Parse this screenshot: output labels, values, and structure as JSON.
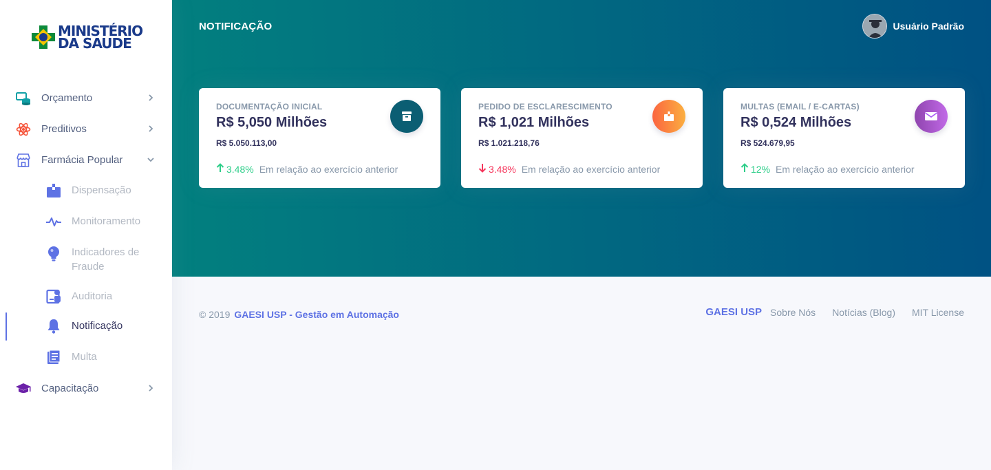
{
  "logo": {
    "line1": "MINISTÉRIO",
    "line2": "DA SAUDE"
  },
  "sidebar": {
    "items": [
      {
        "label": "Orçamento",
        "icon": "database-money-icon",
        "color": "#11a0a6"
      },
      {
        "label": "Preditivos",
        "icon": "atom-icon",
        "color": "#f5553c"
      },
      {
        "label": "Farmácia Popular",
        "icon": "store-icon",
        "color": "#5e72e4"
      },
      {
        "label": "Capacitação",
        "icon": "graduation-cap-icon",
        "color": "#6b21a8"
      }
    ],
    "subitems": [
      {
        "label": "Dispensação",
        "icon": "box-icon"
      },
      {
        "label": "Monitoramento",
        "icon": "pulse-icon"
      },
      {
        "label": "Indicadores de Fraude",
        "icon": "bulb-icon"
      },
      {
        "label": "Auditoria",
        "icon": "id-badge-icon"
      },
      {
        "label": "Notificação",
        "icon": "bell-icon",
        "active": true
      },
      {
        "label": "Multa",
        "icon": "document-icon"
      }
    ]
  },
  "header": {
    "title": "NOTIFICAÇÃO",
    "user": "Usuário Padrão"
  },
  "cards": [
    {
      "title": "DOCUMENTAÇÃO INICIAL",
      "value": "R$ 5,050 Milhões",
      "sub": "R$ 5.050.113,00",
      "pct": "3.48%",
      "trend": "up",
      "note": "Em relação ao exercício anterior",
      "icon": "archive-icon",
      "iconColor": "#0b5e73"
    },
    {
      "title": "PEDIDO DE ESCLARESCIMENTO",
      "value": "R$ 1,021 Milhões",
      "sub": "R$ 1.021.218,76",
      "pct": "3.48%",
      "trend": "down",
      "note": "Em relação ao exercício anterior",
      "icon": "open-box-icon",
      "iconColor": "#fb6340"
    },
    {
      "title": "MULTAS (EMAIL / E-CARTAS)",
      "value": "R$ 0,524 Milhões",
      "sub": "R$ 524.679,95",
      "pct": "12%",
      "trend": "up",
      "note": "Em relação ao exercício anterior",
      "icon": "envelope-icon",
      "iconColor": "#a855f7"
    }
  ],
  "footer": {
    "copyright": "© 2019",
    "brand": "GAESI USP - Gestão em Automação",
    "links": [
      "GAESI USP",
      "Sobre Nós",
      "Notícias (Blog)",
      "MIT License"
    ]
  }
}
